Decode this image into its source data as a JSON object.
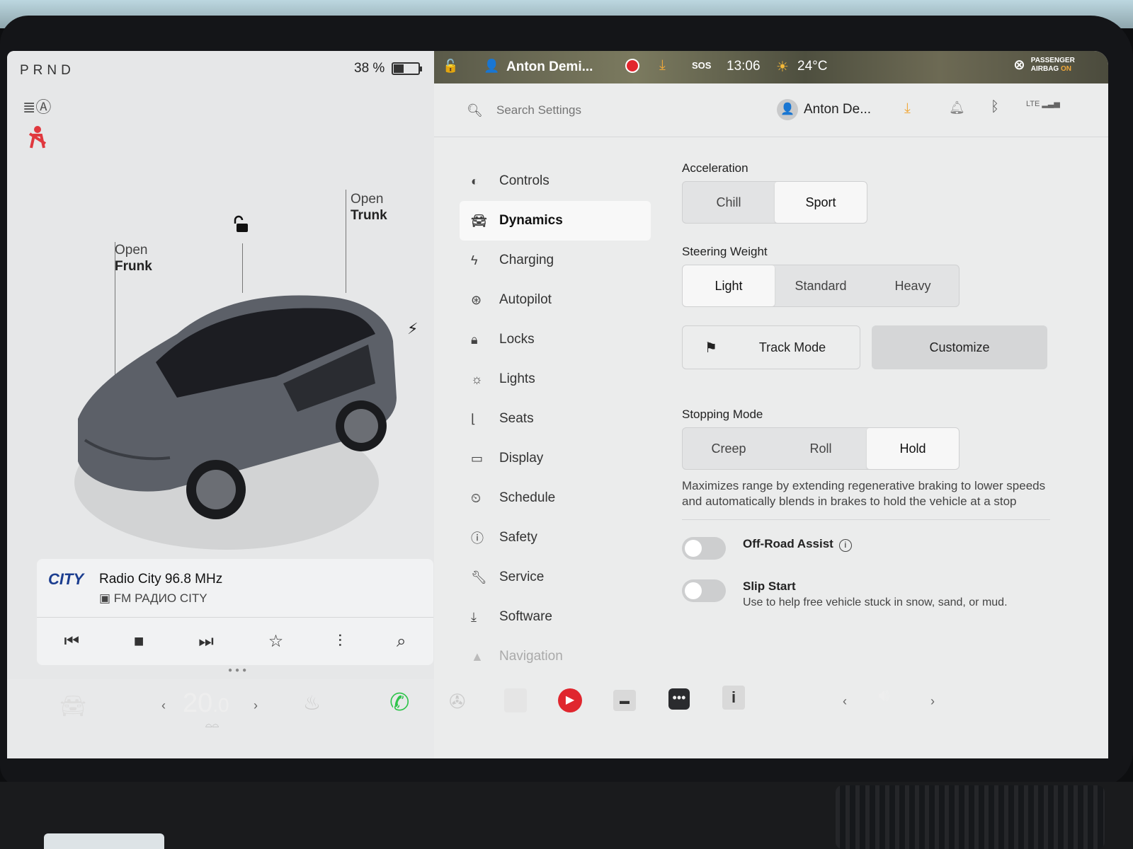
{
  "drive_state": {
    "gears": "PRND",
    "battery_percent": "38 %",
    "battery_level": 0.38
  },
  "vehicle": {
    "frunk_label_1": "Open",
    "frunk_label_2": "Frunk",
    "trunk_label_1": "Open",
    "trunk_label_2": "Trunk"
  },
  "media": {
    "station_logo": "CITY",
    "station_title": "Radio City 96.8 MHz",
    "station_subtitle": "FM РАДИО CITY"
  },
  "status_bar": {
    "profile_name": "Anton Demi...",
    "sos_label": "SOS",
    "time": "13:06",
    "temperature": "24°C",
    "airbag_label": "PASSENGER",
    "airbag_prefix": "AIRBAG",
    "airbag_state": "ON"
  },
  "settings_header": {
    "search_placeholder": "Search Settings",
    "profile_name": "Anton De...",
    "network": "LTE"
  },
  "menu": [
    {
      "label": "Controls",
      "icon": "toggle-icon"
    },
    {
      "label": "Dynamics",
      "icon": "car-icon",
      "active": true
    },
    {
      "label": "Charging",
      "icon": "bolt-icon"
    },
    {
      "label": "Autopilot",
      "icon": "steering-wheel-icon"
    },
    {
      "label": "Locks",
      "icon": "lock-icon"
    },
    {
      "label": "Lights",
      "icon": "light-icon"
    },
    {
      "label": "Seats",
      "icon": "seat-icon"
    },
    {
      "label": "Display",
      "icon": "display-icon"
    },
    {
      "label": "Schedule",
      "icon": "schedule-icon"
    },
    {
      "label": "Safety",
      "icon": "safety-icon"
    },
    {
      "label": "Service",
      "icon": "wrench-icon"
    },
    {
      "label": "Software",
      "icon": "download-icon"
    },
    {
      "label": "Navigation",
      "icon": "navigation-icon"
    }
  ],
  "dynamics": {
    "acceleration": {
      "title": "Acceleration",
      "options": [
        "Chill",
        "Sport"
      ],
      "selected": "Sport"
    },
    "steering": {
      "title": "Steering Weight",
      "options": [
        "Light",
        "Standard",
        "Heavy"
      ],
      "selected": "Light"
    },
    "track_mode_label": "Track Mode",
    "customize_label": "Customize",
    "stopping": {
      "title": "Stopping Mode",
      "options": [
        "Creep",
        "Roll",
        "Hold"
      ],
      "selected": "Hold",
      "description": "Maximizes range by extending regenerative braking to lower speeds and automatically blends in brakes to hold the vehicle at a stop"
    },
    "offroad": {
      "title": "Off-Road Assist",
      "enabled": false
    },
    "slip_start": {
      "title": "Slip Start",
      "subtitle": "Use to help free vehicle stuck in snow, sand, or mud.",
      "enabled": false
    }
  },
  "dock": {
    "cabin_temp": "20",
    "cabin_temp_decimal": ".0"
  },
  "colors": {
    "accent_orange": "#f0a83a",
    "record_red": "#e2262e",
    "phone_green": "#2ec44a",
    "seatbelt_red": "#e0383e"
  }
}
